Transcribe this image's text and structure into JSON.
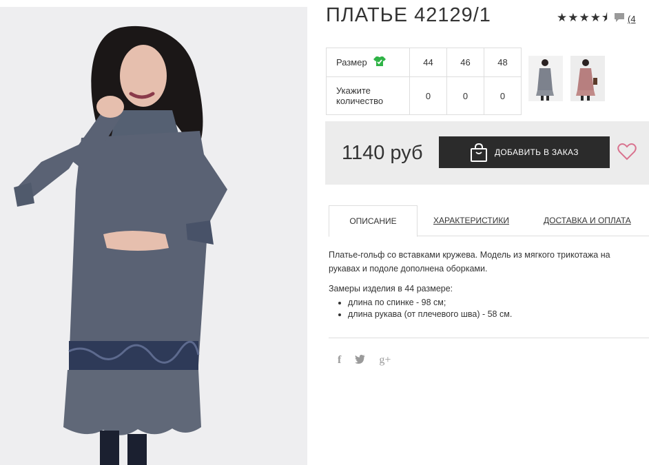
{
  "product": {
    "title": "ПЛАТЬЕ 42129/1",
    "stars": "★★★★⯨",
    "review_count": "(4"
  },
  "sizes": {
    "size_label": "Размер",
    "qty_label": "Укажите количество",
    "columns": [
      "44",
      "46",
      "48"
    ],
    "quantities": [
      "0",
      "0",
      "0"
    ]
  },
  "buy": {
    "price": "1140 руб",
    "add_button_label": "ДОБАВИТЬ В ЗАКАЗ"
  },
  "tabs": [
    {
      "label": "ОПИСАНИЕ",
      "active": true
    },
    {
      "label": "ХАРАКТЕРИСТИКИ",
      "active": false
    },
    {
      "label": "ДОСТАВКА И ОПЛАТА",
      "active": false
    }
  ],
  "description": {
    "text": "Платье-гольф со вставками кружева. Модель из мягкого трикотажа на рукавах и подоле дополнена оборками.",
    "measures_title": "Замеры изделия в 44 размере:",
    "measures": [
      "длина по спинке - 98 см;",
      "длина рукава (от плечевого шва) - 58 см."
    ]
  },
  "share": {
    "facebook": "f",
    "twitter": "🐦",
    "googleplus": "g+"
  },
  "colors": {
    "accent_pink": "#d9738f",
    "size_icon_green": "#2fb346",
    "button_dark": "#2b2b2b",
    "dress_blue_gray": "#5a6274"
  },
  "icons": [
    "comment-icon",
    "size-chart-icon",
    "shopping-bag-icon",
    "heart-icon",
    "facebook-icon",
    "twitter-icon",
    "googleplus-icon"
  ]
}
